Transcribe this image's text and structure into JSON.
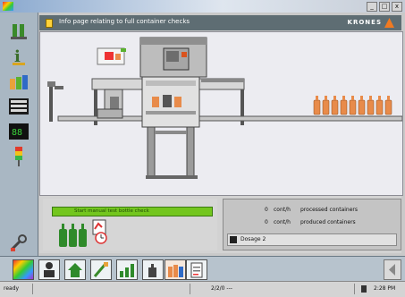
{
  "window": {
    "title": "",
    "minimize": "_",
    "maximize": "□",
    "close": "x"
  },
  "header": {
    "title": "Info page relating to full container checks",
    "brand": "KRONES"
  },
  "left_toolbar": {
    "icons": [
      "machine-icon",
      "info-icon",
      "bottles-icon",
      "counters-icon",
      "digital-display-icon",
      "signal-light-icon",
      "wrench-icon"
    ]
  },
  "bottom_panel": {
    "check_label": "Start manual test bottle check",
    "counters": [
      {
        "value": "0",
        "unit": "cont/h",
        "label": "processed containers"
      },
      {
        "value": "0",
        "unit": "cont/h",
        "label": "produced containers"
      }
    ],
    "message": "Dosage 2"
  },
  "taskbar": {
    "icons": [
      "color-palette-icon",
      "operator-icon",
      "home-icon",
      "paint-icon",
      "chart-icon",
      "hand-icon",
      "bottles-pack-icon",
      "document-icon"
    ]
  },
  "status": {
    "left": "ready",
    "center": "2/2/0 ---",
    "right": "2:28 PM"
  },
  "colors": {
    "accent_green": "#73c61e",
    "header_bg": "#5e6d73",
    "titlebar": "#8aa9cf",
    "bottle": "#e88b4a"
  }
}
